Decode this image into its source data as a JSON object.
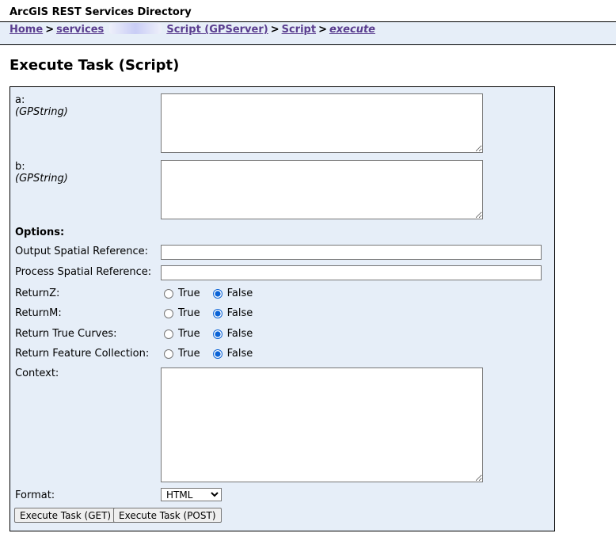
{
  "header": {
    "title": "ArcGIS REST Services Directory"
  },
  "breadcrumb": {
    "home": "Home",
    "services": "services",
    "separator": ">",
    "service": "Script (GPServer)",
    "task": "Script",
    "current": "execute"
  },
  "page": {
    "title": "Execute Task (Script)"
  },
  "form": {
    "param_a": {
      "label": "a:",
      "type": "(GPString)",
      "value": ""
    },
    "param_b": {
      "label": "b:",
      "type": "(GPString)",
      "value": ""
    },
    "options_heading": "Options:",
    "output_sr": {
      "label": "Output Spatial Reference:",
      "value": ""
    },
    "process_sr": {
      "label": "Process Spatial Reference:",
      "value": ""
    },
    "return_z": {
      "label": "ReturnZ:",
      "true_label": "True",
      "false_label": "False",
      "selected": "False"
    },
    "return_m": {
      "label": "ReturnM:",
      "true_label": "True",
      "false_label": "False",
      "selected": "False"
    },
    "return_true_curves": {
      "label": "Return True Curves:",
      "true_label": "True",
      "false_label": "False",
      "selected": "False"
    },
    "return_feature_collection": {
      "label": "Return Feature Collection:",
      "true_label": "True",
      "false_label": "False",
      "selected": "False"
    },
    "context": {
      "label": "Context:",
      "value": ""
    },
    "format": {
      "label": "Format:",
      "selected": "HTML"
    },
    "buttons": {
      "execute_get": "Execute Task (GET)",
      "execute_post": "Execute Task (POST)"
    }
  },
  "colors": {
    "panel_background": "#e6eef8",
    "link": "#5a3d8f",
    "radio_accent": "#0b63d6"
  }
}
